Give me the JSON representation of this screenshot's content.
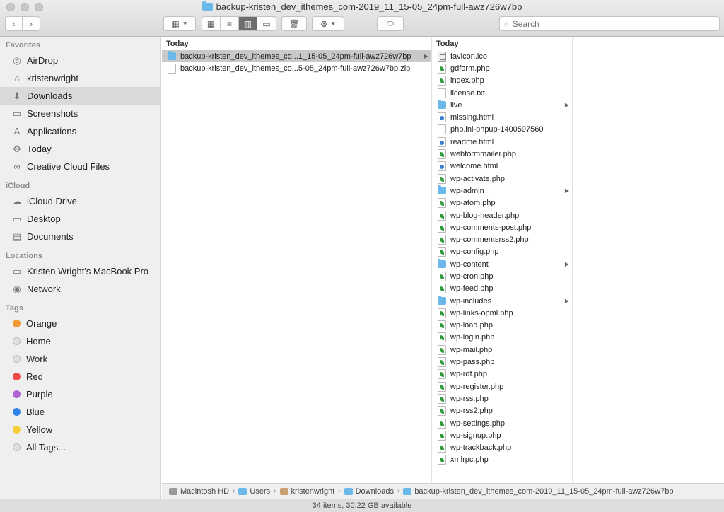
{
  "window": {
    "title": "backup-kristen_dev_ithemes_com-2019_11_15-05_24pm-full-awz726w7bp"
  },
  "toolbar": {
    "back_icon": "chevron-left-icon",
    "forward_icon": "chevron-right-icon",
    "search_placeholder": "Search"
  },
  "sidebar": {
    "favorites_title": "Favorites",
    "favorites": [
      {
        "label": "AirDrop",
        "icon": "airdrop-icon",
        "glyph": "◎"
      },
      {
        "label": "kristenwright",
        "icon": "home-icon",
        "glyph": "⌂"
      },
      {
        "label": "Downloads",
        "icon": "downloads-icon",
        "glyph": "⬇"
      },
      {
        "label": "Screenshots",
        "icon": "folder-icon",
        "glyph": "▭"
      },
      {
        "label": "Applications",
        "icon": "applications-icon",
        "glyph": "A"
      },
      {
        "label": "Today",
        "icon": "gear-icon",
        "glyph": "⚙"
      },
      {
        "label": "Creative Cloud Files",
        "icon": "creative-cloud-icon",
        "glyph": "∞"
      }
    ],
    "icloud_title": "iCloud",
    "icloud": [
      {
        "label": "iCloud Drive",
        "icon": "cloud-icon",
        "glyph": "☁"
      },
      {
        "label": "Desktop",
        "icon": "desktop-icon",
        "glyph": "▭"
      },
      {
        "label": "Documents",
        "icon": "documents-icon",
        "glyph": "▤"
      }
    ],
    "locations_title": "Locations",
    "locations": [
      {
        "label": "Kristen Wright's MacBook Pro",
        "icon": "laptop-icon",
        "glyph": "▭"
      },
      {
        "label": "Network",
        "icon": "globe-icon",
        "glyph": "◉"
      }
    ],
    "tags_title": "Tags",
    "tags": [
      {
        "label": "Orange",
        "color": "#f39a33"
      },
      {
        "label": "Home",
        "color": "#e0e0e0"
      },
      {
        "label": "Work",
        "color": "#e0e0e0"
      },
      {
        "label": "Red",
        "color": "#ef4a4a"
      },
      {
        "label": "Purple",
        "color": "#b066d1"
      },
      {
        "label": "Blue",
        "color": "#2f82e7"
      },
      {
        "label": "Yellow",
        "color": "#f5cf35"
      },
      {
        "label": "All Tags...",
        "color": "#e0e0e0"
      }
    ]
  },
  "column1": {
    "header": "Today",
    "items": [
      {
        "name": "backup-kristen_dev_ithemes_co...1_15-05_24pm-full-awz726w7bp",
        "type": "folder",
        "selected": true,
        "arrow": true
      },
      {
        "name": "backup-kristen_dev_ithemes_co...5-05_24pm-full-awz726w7bp.zip",
        "type": "zip",
        "selected": false,
        "arrow": false
      }
    ]
  },
  "column2": {
    "header": "Today",
    "items": [
      {
        "name": "favicon.ico",
        "type": "ico"
      },
      {
        "name": "gdform.php",
        "type": "php"
      },
      {
        "name": "index.php",
        "type": "php"
      },
      {
        "name": "license.txt",
        "type": "plain"
      },
      {
        "name": "live",
        "type": "folder",
        "arrow": true
      },
      {
        "name": "missing.html",
        "type": "html"
      },
      {
        "name": "php.ini-phpup-1400597560",
        "type": "plain"
      },
      {
        "name": "readme.html",
        "type": "html"
      },
      {
        "name": "webformmailer.php",
        "type": "php"
      },
      {
        "name": "welcome.html",
        "type": "html"
      },
      {
        "name": "wp-activate.php",
        "type": "php"
      },
      {
        "name": "wp-admin",
        "type": "folder",
        "arrow": true
      },
      {
        "name": "wp-atom.php",
        "type": "php"
      },
      {
        "name": "wp-blog-header.php",
        "type": "php"
      },
      {
        "name": "wp-comments-post.php",
        "type": "php"
      },
      {
        "name": "wp-commentsrss2.php",
        "type": "php"
      },
      {
        "name": "wp-config.php",
        "type": "php"
      },
      {
        "name": "wp-content",
        "type": "folder",
        "arrow": true
      },
      {
        "name": "wp-cron.php",
        "type": "php"
      },
      {
        "name": "wp-feed.php",
        "type": "php"
      },
      {
        "name": "wp-includes",
        "type": "folder",
        "arrow": true
      },
      {
        "name": "wp-links-opml.php",
        "type": "php"
      },
      {
        "name": "wp-load.php",
        "type": "php"
      },
      {
        "name": "wp-login.php",
        "type": "php"
      },
      {
        "name": "wp-mail.php",
        "type": "php"
      },
      {
        "name": "wp-pass.php",
        "type": "php"
      },
      {
        "name": "wp-rdf.php",
        "type": "php"
      },
      {
        "name": "wp-register.php",
        "type": "php"
      },
      {
        "name": "wp-rss.php",
        "type": "php"
      },
      {
        "name": "wp-rss2.php",
        "type": "php"
      },
      {
        "name": "wp-settings.php",
        "type": "php"
      },
      {
        "name": "wp-signup.php",
        "type": "php"
      },
      {
        "name": "wp-trackback.php",
        "type": "php"
      },
      {
        "name": "xmlrpc.php",
        "type": "php"
      }
    ]
  },
  "pathbar": [
    {
      "label": "Macintosh HD",
      "icon": "hd"
    },
    {
      "label": "Users",
      "icon": "blue"
    },
    {
      "label": "kristenwright",
      "icon": "home"
    },
    {
      "label": "Downloads",
      "icon": "blue"
    },
    {
      "label": "backup-kristen_dev_ithemes_com-2019_11_15-05_24pm-full-awz726w7bp",
      "icon": "blue"
    }
  ],
  "status": {
    "text": "34 items, 30.22 GB available"
  }
}
